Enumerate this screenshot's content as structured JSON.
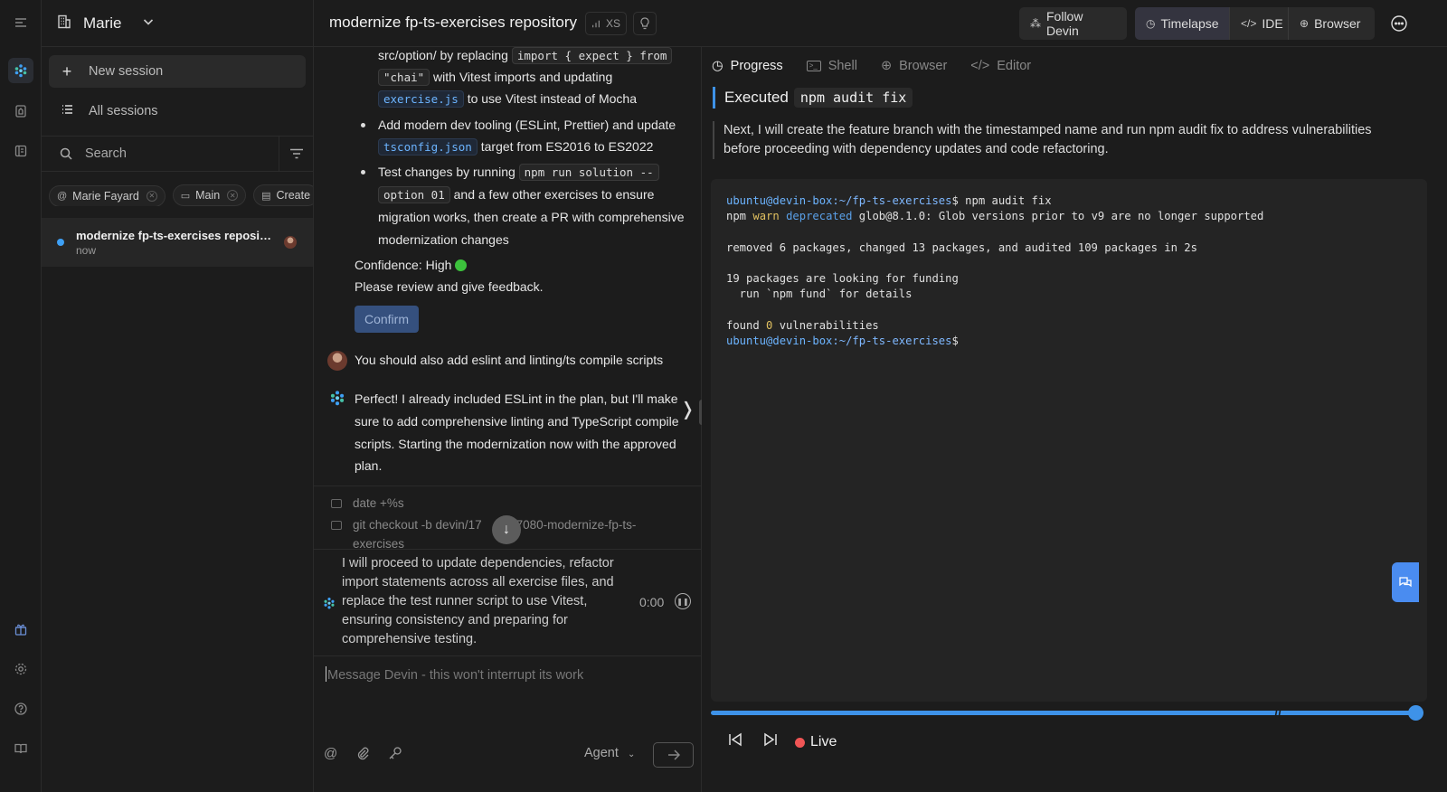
{
  "workspace": {
    "name": "Marie"
  },
  "sidebar": {
    "new_session": "New session",
    "all_sessions": "All sessions",
    "search_placeholder": "Search",
    "chips": [
      "Marie Fayard",
      "Main",
      "Create"
    ],
    "session": {
      "title": "modernize fp-ts-exercises reposito...",
      "time": "now"
    }
  },
  "header": {
    "title": "modernize fp-ts-exercises repository",
    "size_badge": "XS",
    "follow": "Follow Devin",
    "timelapse": "Timelapse",
    "ide": "IDE",
    "browser": "Browser"
  },
  "chat": {
    "b1": {
      "pre": "src/option/ by replacing",
      "code1": "import { expect } from",
      "code2": "\"chai\"",
      "mid": "with Vitest imports and updating",
      "code3": "exercise.js",
      "post": "to use Vitest instead of Mocha"
    },
    "b2": {
      "l1": "Add modern dev tooling (ESLint, Prettier) and update",
      "code": "tsconfig.json",
      "l2": "target from ES2016 to ES2022"
    },
    "b3": {
      "pre": "Test changes by running",
      "code1": "npm run solution --",
      "code2": "option 01",
      "l1": "and a few other exercises to ensure",
      "l2": "migration works, then create a PR with comprehensive",
      "l3": "modernization changes"
    },
    "confidence": "Confidence: High",
    "review": "Please review and give feedback.",
    "confirm": "Confirm",
    "user_msg": "You should also add eslint and linting/ts compile scripts",
    "devin_reply": [
      "Perfect! I already included ESLint in the plan, but I'll make",
      "sure to add comprehensive linting and TypeScript compile",
      "scripts. Starting the modernization now with the approved",
      "plan."
    ],
    "cmd1": "date +%s",
    "cmd2": "git checkout -b devin/17",
    "cmd2b": "7080-modernize-fp-ts-",
    "cmd2c": "exercises",
    "live_message": "I will proceed to update dependencies, refactor import statements across all exercise files, and replace the test runner script to use Vitest, ensuring consistency and preparing for comprehensive testing.",
    "timer": "0:00",
    "input_placeholder": "Message Devin - this won't interrupt its work",
    "agent": "Agent"
  },
  "right": {
    "tabs": [
      "Progress",
      "Shell",
      "Browser",
      "Editor"
    ],
    "executed_label": "Executed",
    "executed_cmd": "npm audit fix",
    "note": "Next, I will create the feature branch with the timestamped name and run npm audit fix to address vulnerabilities before proceeding with dependency updates and code refactoring.",
    "terminal": {
      "prompt": "ubuntu@devin-box",
      "path": ":~/fp-ts-exercises",
      "cmd": "$ npm audit fix",
      "warn1": "npm",
      "warn2": "warn",
      "warn3": "deprecated",
      "warn4": " glob@8.1.0: Glob versions prior to v9 are no longer supported",
      "l_removed": "removed 6 packages, changed 13 packages, and audited 109 packages in 2s",
      "l_funding": "19 packages are looking for funding",
      "l_fund": "  run `npm fund` for details",
      "l_found_a": "found ",
      "l_found_n": "0",
      "l_found_b": " vulnerabilities",
      "end": "$"
    },
    "live": "Live",
    "progress": 1.0
  },
  "colors": {
    "accent": "#3e92e8",
    "live": "#f05555",
    "bg": "#1c1c1c"
  }
}
